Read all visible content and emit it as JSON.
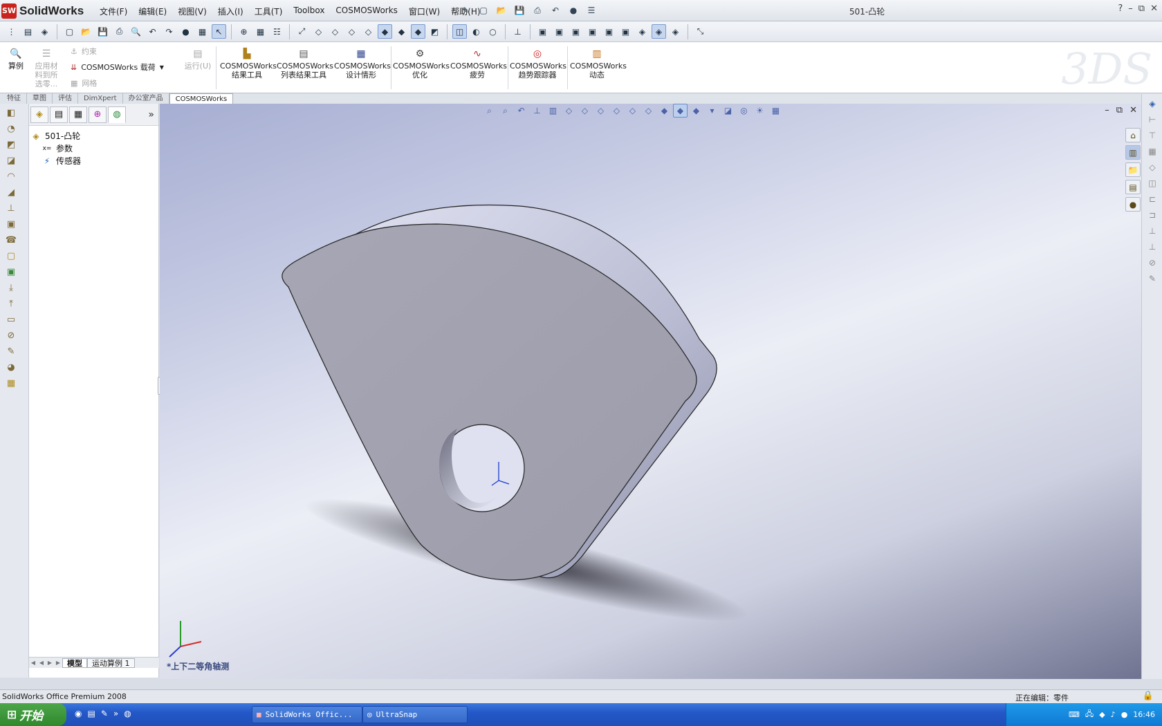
{
  "app": {
    "name": "SolidWorks",
    "doc_title": "501-凸轮"
  },
  "menus": [
    "文件(F)",
    "编辑(E)",
    "视图(V)",
    "插入(I)",
    "工具(T)",
    "Toolbox",
    "COSMOSWorks",
    "窗口(W)",
    "帮助(H)"
  ],
  "window_controls": {
    "help": "?",
    "minimize": "–",
    "restore": "⧉",
    "close": "✕"
  },
  "command_manager": {
    "study_label": "算例",
    "apply_material_label": "应用材料到所选零...",
    "constraint_label": "约束",
    "load_label": "COSMOSWorks 载荷",
    "mesh_label": "网格",
    "run_label": "运行(U)",
    "groups": [
      {
        "line1": "COSMOSWorks",
        "line2": "结果工具"
      },
      {
        "line1": "COSMOSWorks",
        "line2": "列表结果工具"
      },
      {
        "line1": "COSMOSWorks",
        "line2": "设计情形"
      },
      {
        "line1": "COSMOSWorks",
        "line2": "优化"
      },
      {
        "line1": "COSMOSWorks",
        "line2": "疲劳"
      },
      {
        "line1": "COSMOSWorks",
        "line2": "趋势跟踪器"
      },
      {
        "line1": "COSMOSWorks",
        "line2": "动态"
      }
    ]
  },
  "cm_tabs": [
    "特征",
    "草图",
    "评估",
    "DimXpert",
    "办公室产品",
    "COSMOSWorks"
  ],
  "feature_tree": {
    "root": "501-凸轮",
    "items": [
      "参数",
      "传感器"
    ]
  },
  "bottom_tabs": [
    "模型",
    "运动算例 1"
  ],
  "viewport": {
    "view_name": "*上下二等角轴测"
  },
  "status": {
    "product": "SolidWorks Office Premium 2008",
    "editing": "正在编辑：零件"
  },
  "taskbar": {
    "start_label": "开始",
    "tasks": [
      "SolidWorks Offic...",
      "UltraSnap"
    ],
    "clock": "16:46"
  }
}
